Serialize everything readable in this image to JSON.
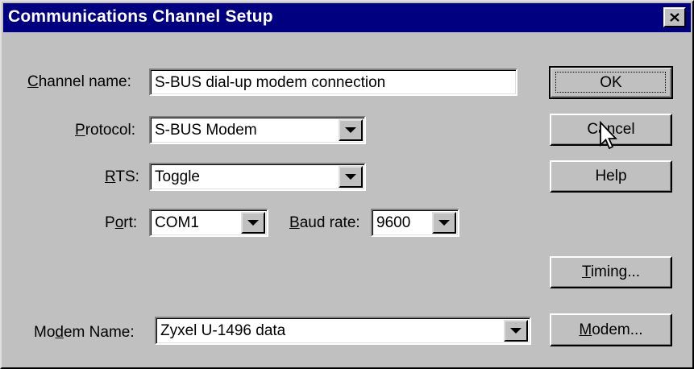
{
  "window": {
    "title": "Communications Channel Setup"
  },
  "labels": {
    "channel_name": {
      "pre": "",
      "key": "C",
      "post": "hannel name:"
    },
    "protocol": {
      "pre": "",
      "key": "P",
      "post": "rotocol:"
    },
    "rts": {
      "pre": "",
      "key": "R",
      "post": "TS:"
    },
    "port": {
      "pre": "P",
      "key": "o",
      "post": "rt:"
    },
    "baud_rate": {
      "pre": "",
      "key": "B",
      "post": "aud rate:"
    },
    "modem_name": {
      "pre": "Mo",
      "key": "d",
      "post": "em Name:"
    }
  },
  "fields": {
    "channel_name": "S-BUS dial-up modem connection",
    "protocol": "S-BUS Modem",
    "rts": "Toggle",
    "port": "COM1",
    "baud_rate": "9600",
    "modem_name": "Zyxel U-1496 data"
  },
  "buttons": {
    "ok": {
      "pre": "OK",
      "key": "",
      "post": ""
    },
    "cancel": {
      "pre": "Cancel",
      "key": "",
      "post": ""
    },
    "help": {
      "pre": "Help",
      "key": "",
      "post": ""
    },
    "timing": {
      "pre": "",
      "key": "T",
      "post": "iming..."
    },
    "modem": {
      "pre": "",
      "key": "M",
      "post": "odem..."
    }
  },
  "icons": {
    "close": "close-icon",
    "dropdown": "chevron-down-icon",
    "cursor": "mouse-pointer-icon"
  }
}
